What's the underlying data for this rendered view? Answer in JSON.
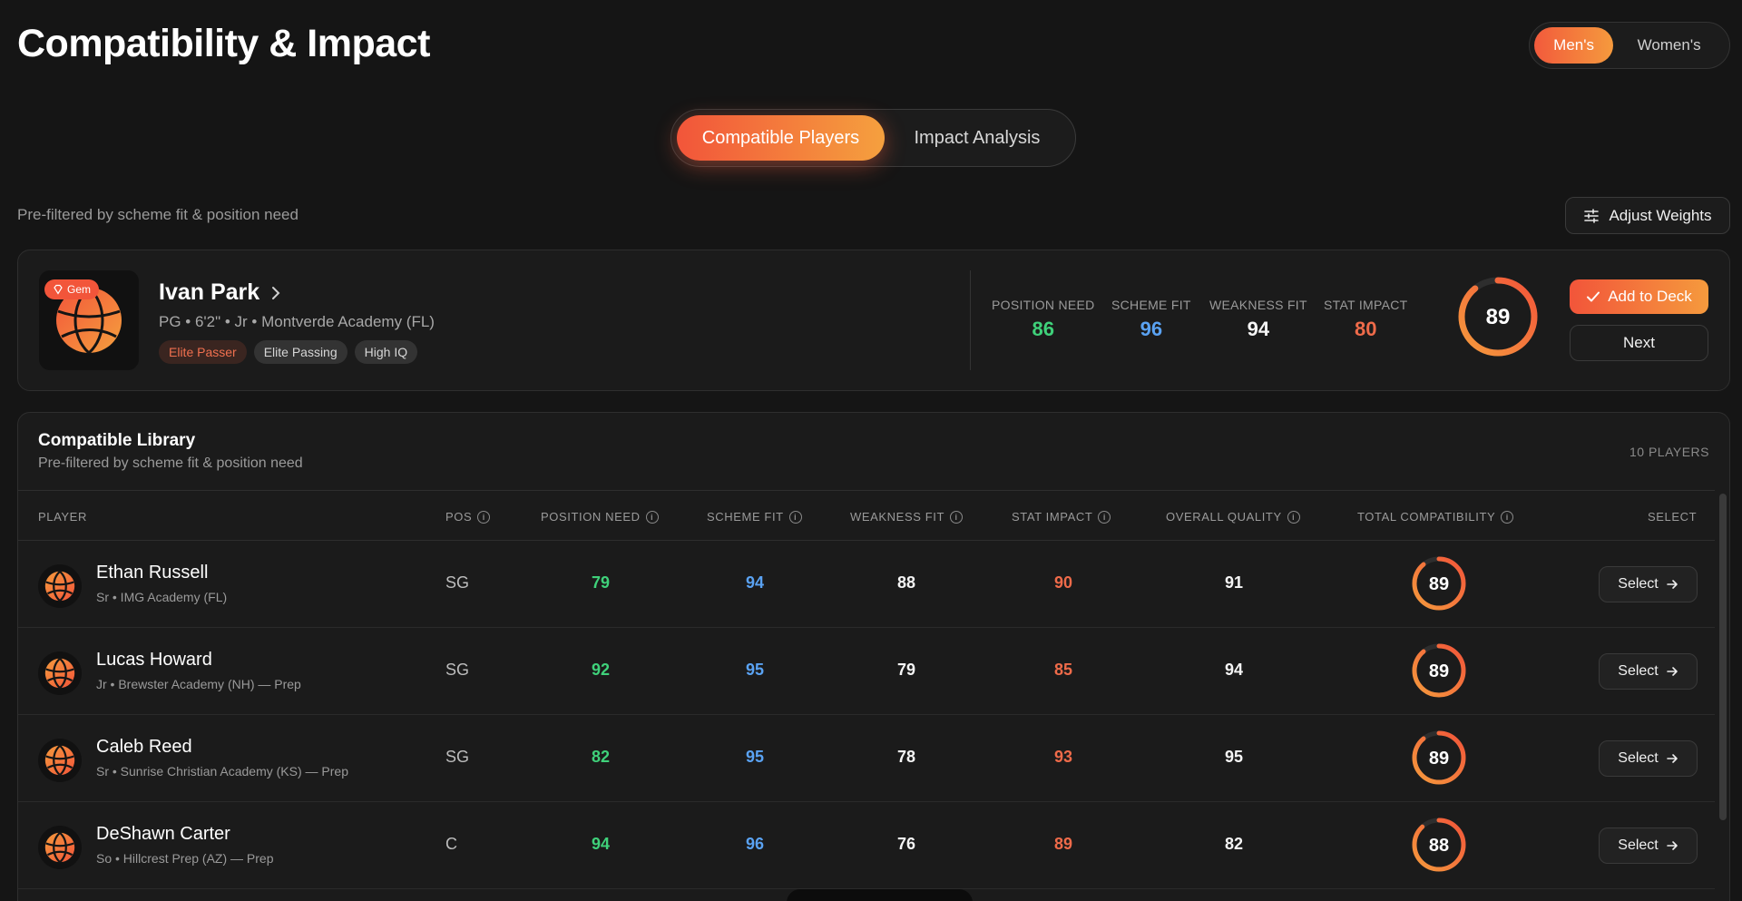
{
  "page": {
    "title": "Compatibility & Impact"
  },
  "gender_toggle": {
    "men": "Men's",
    "women": "Women's"
  },
  "view_tabs": {
    "compatible": "Compatible Players",
    "impact": "Impact Analysis"
  },
  "prefilter_note": "Pre-filtered by scheme fit & position need",
  "adjust_weights_label": "Adjust Weights",
  "featured": {
    "badge": "Gem",
    "name": "Ivan Park",
    "meta": "PG • 6'2\" • Jr • Montverde Academy (FL)",
    "tags": [
      "Elite Passer",
      "Elite Passing",
      "High IQ"
    ],
    "metrics": {
      "position_need": {
        "label": "POSITION NEED",
        "value": "86"
      },
      "scheme_fit": {
        "label": "SCHEME FIT",
        "value": "96"
      },
      "weakness_fit": {
        "label": "WEAKNESS FIT",
        "value": "94"
      },
      "stat_impact": {
        "label": "STAT IMPACT",
        "value": "80"
      }
    },
    "score": 89,
    "score_label": "89",
    "add_label": "Add to Deck",
    "next_label": "Next"
  },
  "library": {
    "title": "Compatible Library",
    "subtitle": "Pre-filtered by scheme fit & position need",
    "count": "10 PLAYERS",
    "columns": {
      "player": "PLAYER",
      "pos": "POS",
      "position_need": "POSITION NEED",
      "scheme_fit": "SCHEME FIT",
      "weakness_fit": "WEAKNESS FIT",
      "stat_impact": "STAT IMPACT",
      "overall_quality": "OVERALL QUALITY",
      "total_compatibility": "TOTAL COMPATIBILITY",
      "select": "SELECT"
    },
    "select_label": "Select",
    "rows": [
      {
        "name": "Ethan Russell",
        "meta": "Sr • IMG Academy (FL)",
        "pos": "SG",
        "position_need": "79",
        "scheme_fit": "94",
        "weakness_fit": "88",
        "stat_impact": "90",
        "overall_quality": "91",
        "total": 89,
        "total_label": "89"
      },
      {
        "name": "Lucas Howard",
        "meta": "Jr • Brewster Academy (NH) — Prep",
        "pos": "SG",
        "position_need": "92",
        "scheme_fit": "95",
        "weakness_fit": "79",
        "stat_impact": "85",
        "overall_quality": "94",
        "total": 89,
        "total_label": "89"
      },
      {
        "name": "Caleb Reed",
        "meta": "Sr • Sunrise Christian Academy (KS) — Prep",
        "pos": "SG",
        "position_need": "82",
        "scheme_fit": "95",
        "weakness_fit": "78",
        "stat_impact": "93",
        "overall_quality": "95",
        "total": 89,
        "total_label": "89"
      },
      {
        "name": "DeShawn Carter",
        "meta": "So • Hillcrest Prep (AZ) — Prep",
        "pos": "C",
        "position_need": "94",
        "scheme_fit": "96",
        "weakness_fit": "76",
        "stat_impact": "89",
        "overall_quality": "82",
        "total": 88,
        "total_label": "88"
      }
    ]
  },
  "colors": {
    "accent_start": "#f2553a",
    "accent_end": "#f59a3d",
    "green": "#3fd17a",
    "blue": "#5aa2f2",
    "orange": "#ef6b4a"
  },
  "icons": {
    "gem": "gem-icon",
    "chevron": "chevron-right-icon",
    "sliders": "sliders-icon",
    "check": "check-icon",
    "arrow": "arrow-right-icon",
    "ball": "basketball-icon",
    "info": "info-icon"
  }
}
